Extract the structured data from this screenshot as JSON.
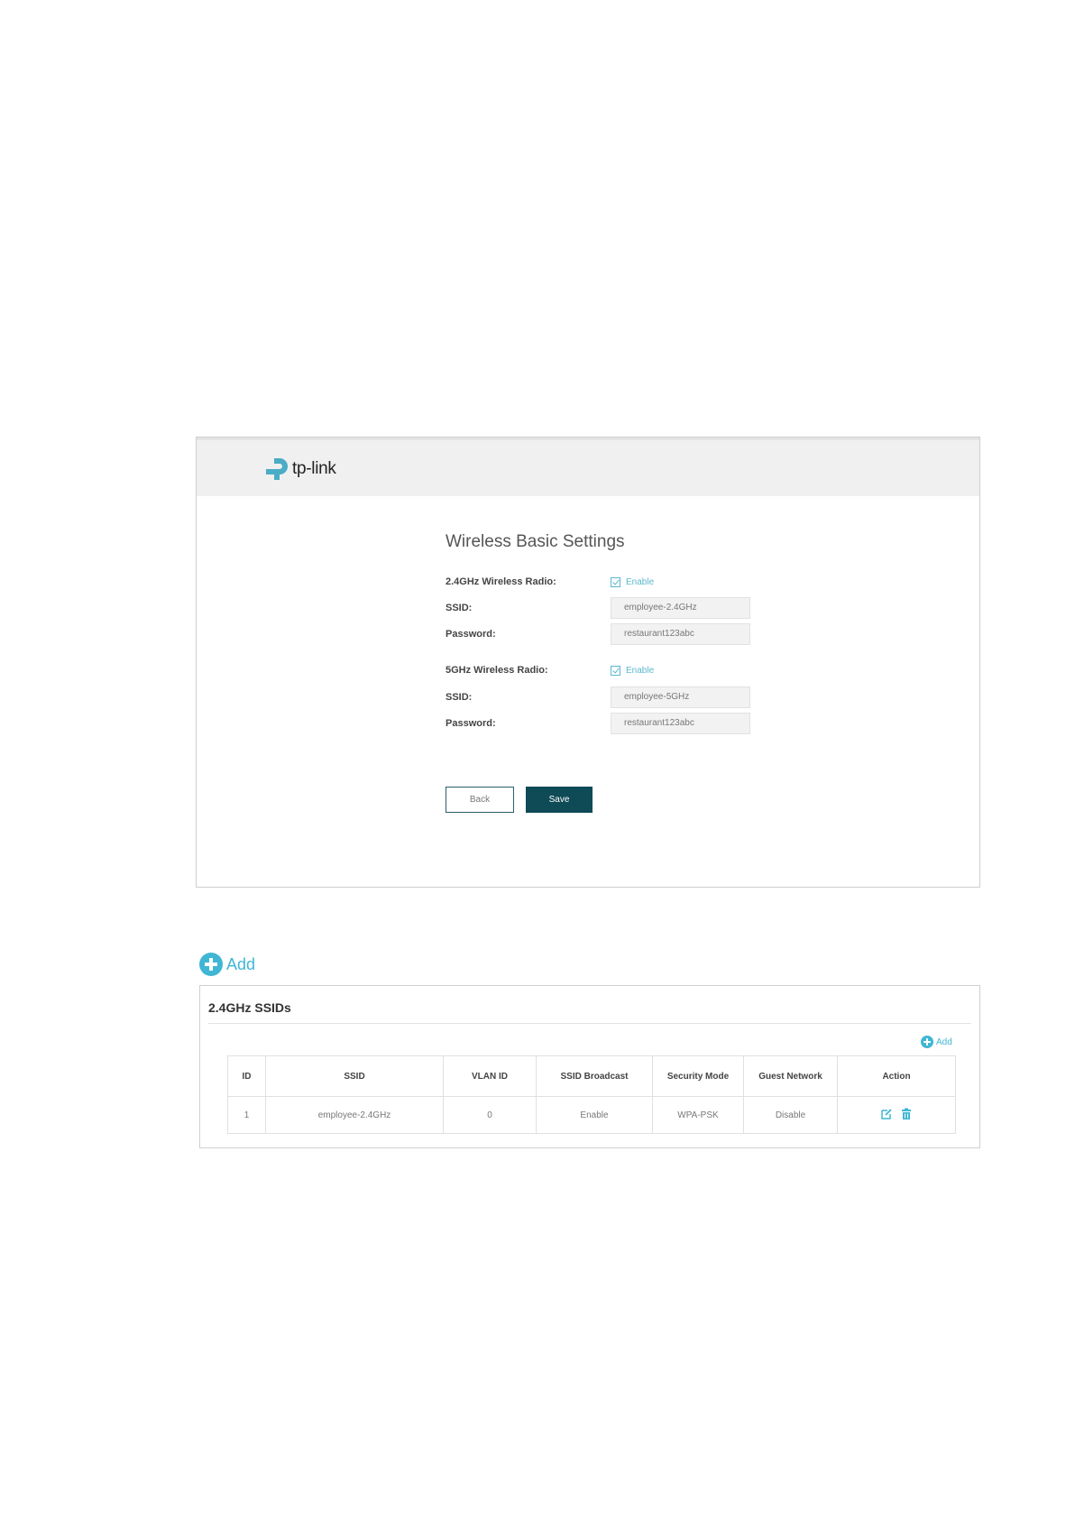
{
  "brand": {
    "name": "tp-link",
    "color": "#4aacc5"
  },
  "wireless_form": {
    "title": "Wireless Basic Settings",
    "radio_24": {
      "label": "2.4GHz Wireless Radio:",
      "enable_label": "Enable",
      "enabled": true
    },
    "ssid_24": {
      "label": "SSID:",
      "value": "employee-2.4GHz"
    },
    "password_24": {
      "label": "Password:",
      "value": "restaurant123abc"
    },
    "radio_5": {
      "label": "5GHz Wireless Radio:",
      "enable_label": "Enable",
      "enabled": true
    },
    "ssid_5": {
      "label": "SSID:",
      "value": "employee-5GHz"
    },
    "password_5": {
      "label": "Password:",
      "value": "restaurant123abc"
    },
    "back_label": "Back",
    "save_label": "Save"
  },
  "add_link": {
    "label": "Add"
  },
  "ssid_panel": {
    "title": "2.4GHz SSIDs",
    "add_label": "Add",
    "columns": [
      "ID",
      "SSID",
      "VLAN ID",
      "SSID Broadcast",
      "Security Mode",
      "Guest Network",
      "Action"
    ],
    "rows": [
      {
        "id": "1",
        "ssid": "employee-2.4GHz",
        "vlan_id": "0",
        "broadcast": "Enable",
        "security": "WPA-PSK",
        "guest": "Disable",
        "actions": [
          "edit-icon",
          "delete-icon"
        ]
      }
    ]
  },
  "colors": {
    "accent": "#3fb6d3",
    "primary_button": "#0f4a57"
  }
}
